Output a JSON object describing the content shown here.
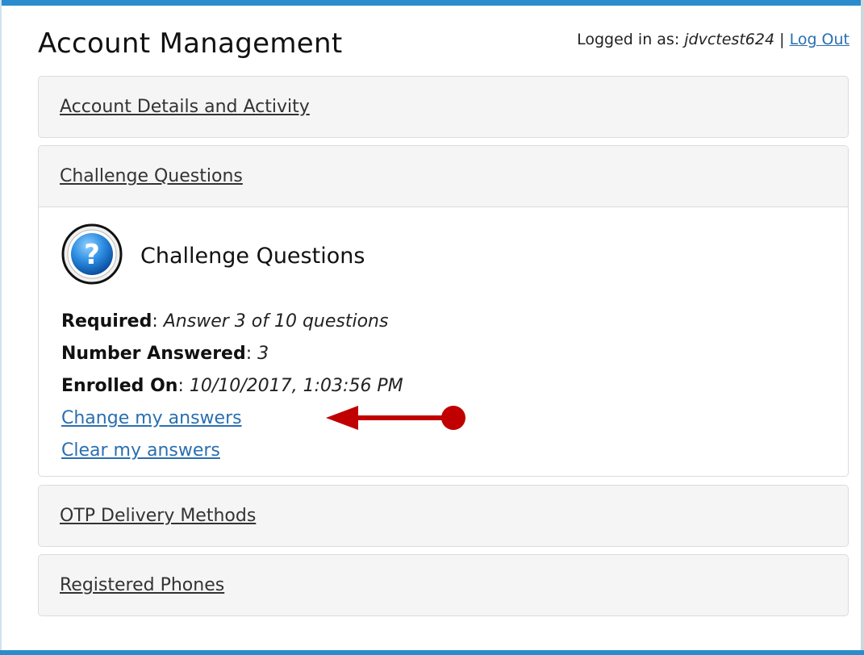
{
  "header": {
    "title": "Account Management",
    "logged_in_prefix": "Logged in as:",
    "username": "jdvctest624",
    "separator": "|",
    "logout": "Log Out"
  },
  "panels": [
    {
      "label": "Account Details and Activity"
    },
    {
      "label": "Challenge Questions"
    },
    {
      "label": "OTP Delivery Methods"
    },
    {
      "label": "Registered Phones"
    }
  ],
  "challenge": {
    "icon": "help-question-icon",
    "title": "Challenge Questions",
    "required_label": "Required",
    "required_value": "Answer 3 of 10 questions",
    "answered_label": "Number Answered",
    "answered_value": "3",
    "enrolled_label": "Enrolled On",
    "enrolled_value": "10/10/2017, 1:03:56 PM",
    "change_link": "Change my answers",
    "clear_link": "Clear my answers"
  },
  "colors": {
    "frame": "#2a8ccc",
    "link": "#2a6fb0",
    "annotation": "#c00000",
    "panel_bg": "#f5f5f5"
  }
}
